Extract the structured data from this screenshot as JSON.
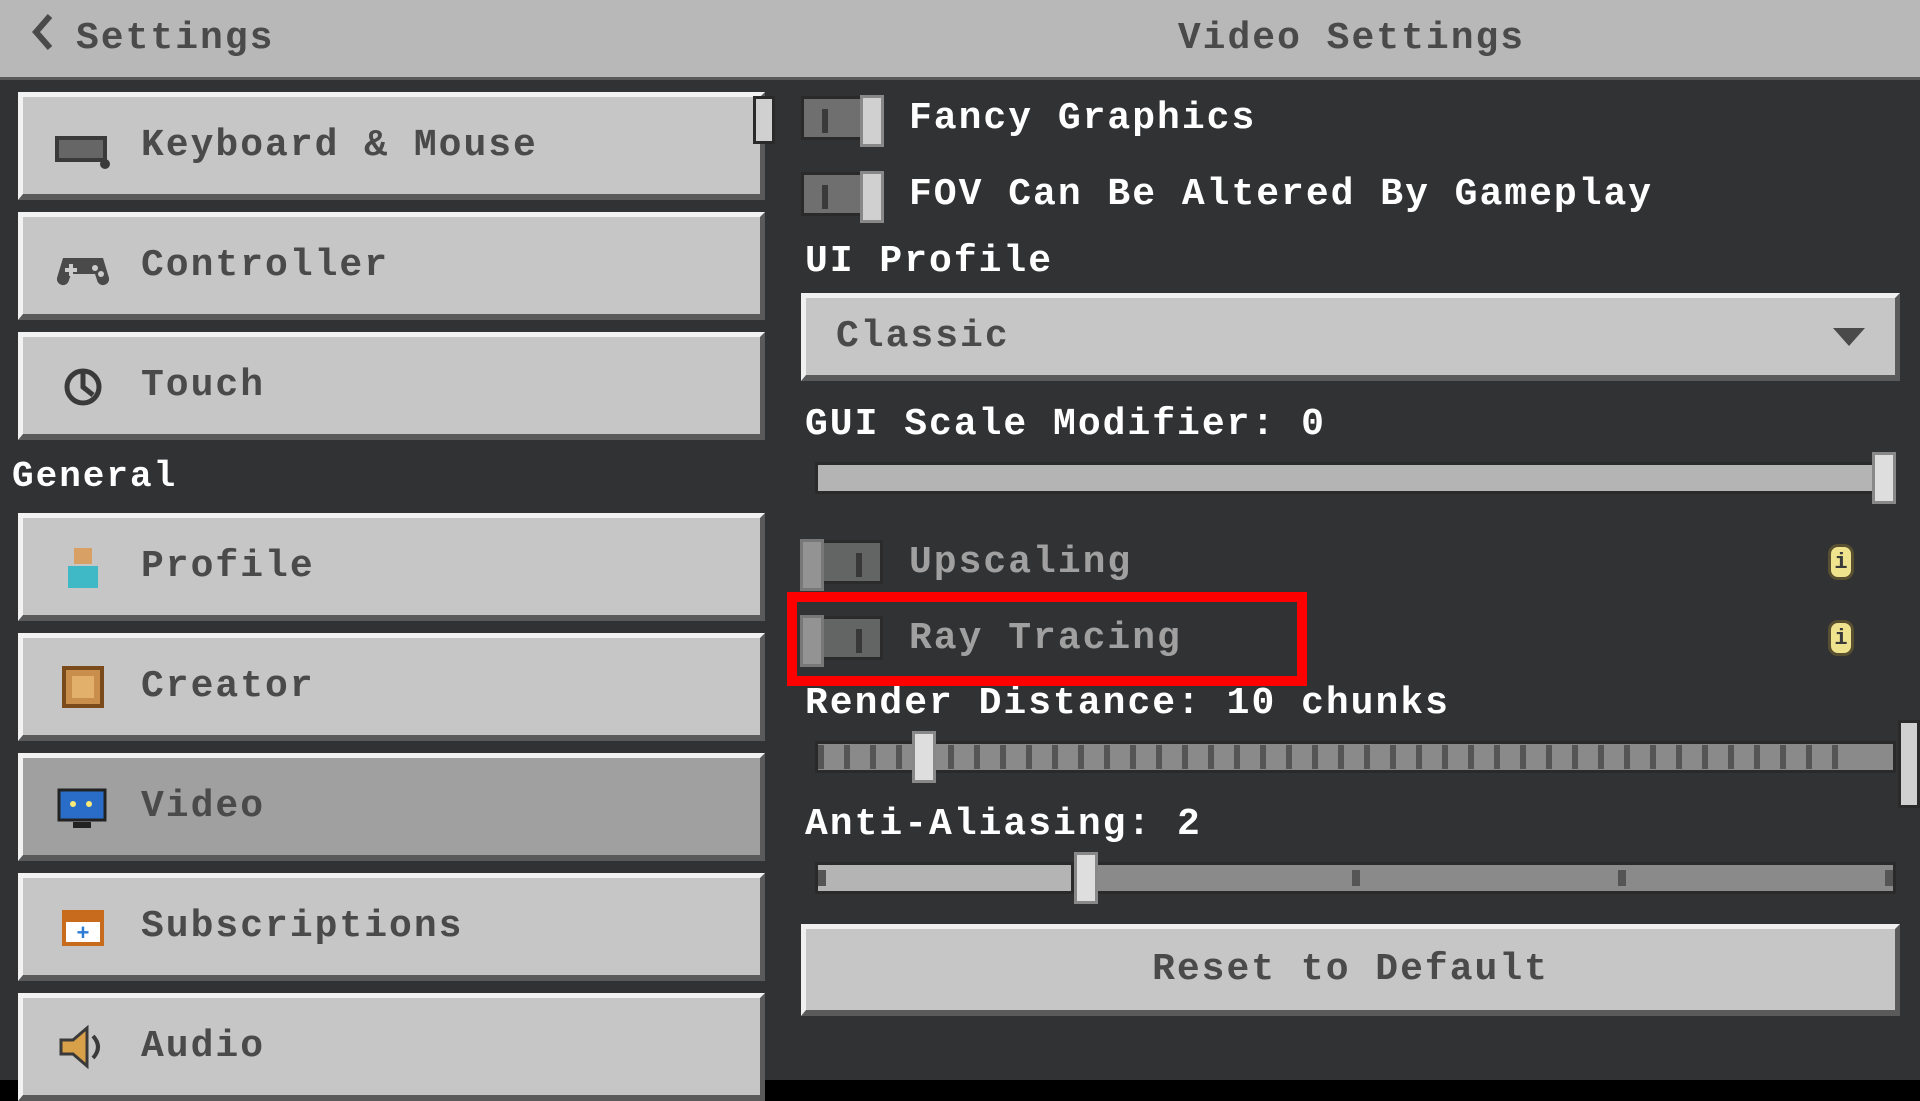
{
  "header": {
    "back_label": "Settings",
    "page_title": "Video Settings"
  },
  "sidebar": {
    "items": [
      {
        "label": "Keyboard & Mouse",
        "icon": "keyboard-icon",
        "selected": false
      },
      {
        "label": "Controller",
        "icon": "controller-icon",
        "selected": false
      },
      {
        "label": "Touch",
        "icon": "touch-icon",
        "selected": false
      }
    ],
    "section_label": "General",
    "general": [
      {
        "label": "Profile",
        "icon": "profile-icon",
        "selected": false
      },
      {
        "label": "Creator",
        "icon": "creator-icon",
        "selected": false
      },
      {
        "label": "Video",
        "icon": "video-icon",
        "selected": true
      },
      {
        "label": "Subscriptions",
        "icon": "subscriptions-icon",
        "selected": false
      },
      {
        "label": "Audio",
        "icon": "audio-icon",
        "selected": false
      }
    ]
  },
  "content": {
    "toggles": {
      "fancy": {
        "label": "Fancy Graphics",
        "on": true,
        "disabled": false
      },
      "fov": {
        "label": "FOV Can Be Altered By Gameplay",
        "on": true,
        "disabled": false
      },
      "upscaling": {
        "label": "Upscaling",
        "on": false,
        "disabled": true
      },
      "raytracing": {
        "label": "Ray Tracing",
        "on": false,
        "disabled": true
      }
    },
    "ui_profile": {
      "label": "UI Profile",
      "value": "Classic"
    },
    "gui_scale": {
      "label": "GUI Scale Modifier: 0",
      "percent": 100
    },
    "render_distance": {
      "label": "Render Distance: 10 chunks",
      "percent": 9
    },
    "anti_aliasing": {
      "label": "Anti-Aliasing: 2",
      "percent": 24,
      "stops": 4
    },
    "reset_label": "Reset to Default"
  },
  "annotation": {
    "target": "ray-tracing-row"
  }
}
